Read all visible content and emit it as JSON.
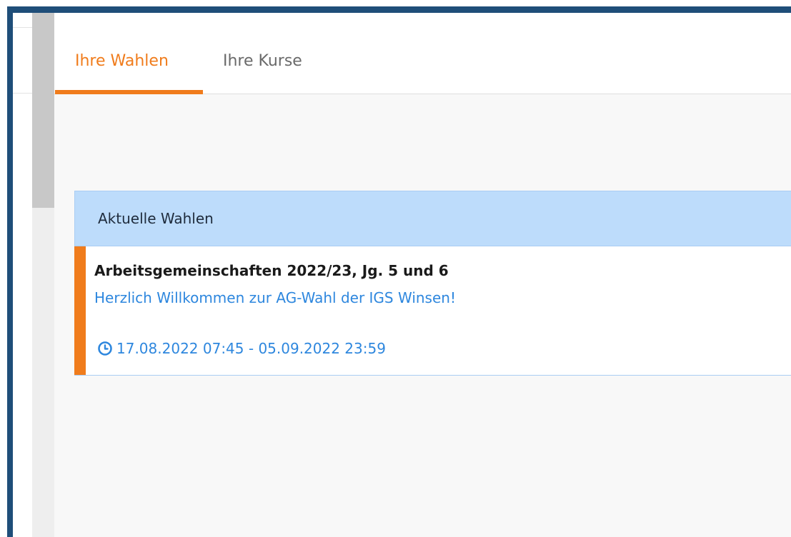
{
  "tabs": [
    {
      "label": "Ihre Wahlen",
      "active": true
    },
    {
      "label": "Ihre Kurse",
      "active": false
    }
  ],
  "card": {
    "header": "Aktuelle Wahlen",
    "items": [
      {
        "title": "Arbeitsgemeinschaften 2022/23, Jg. 5 und 6",
        "description": "Herzlich Willkommen zur AG-Wahl der IGS Winsen!",
        "date_icon": "clock-icon",
        "date_range": "17.08.2022 07:45 - 05.09.2022 23:59"
      }
    ]
  },
  "colors": {
    "accent": "#f07c1c",
    "link": "#2e87de",
    "header_bg": "#bddcfb",
    "frame": "#1f4e79"
  }
}
